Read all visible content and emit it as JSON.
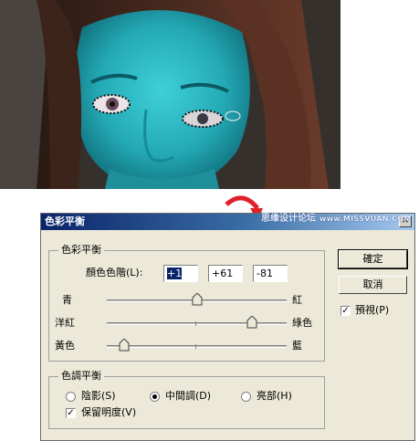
{
  "dialog": {
    "title": "色彩平衡",
    "close_glyph": "×"
  },
  "watermark": {
    "text": "思缘设计论坛",
    "url": "www.MISSVUAN.COM"
  },
  "color_balance": {
    "group_label": "色彩平衡",
    "levels_label": "顏色色階(L):",
    "levels": [
      "+1",
      "+61",
      "-81"
    ],
    "sliders": [
      {
        "left": "青",
        "right": "紅",
        "value": 1
      },
      {
        "left": "洋紅",
        "right": "綠色",
        "value": 61
      },
      {
        "left": "黃色",
        "right": "藍",
        "value": -81
      }
    ],
    "range": [
      -100,
      100
    ]
  },
  "tone_balance": {
    "group_label": "色調平衡",
    "options": [
      {
        "label": "陰影(S)",
        "selected": false
      },
      {
        "label": "中間調(D)",
        "selected": true
      },
      {
        "label": "亮部(H)",
        "selected": false
      }
    ],
    "preserve_luminosity": {
      "label": "保留明度(V)",
      "checked": true
    }
  },
  "buttons": {
    "ok": "確定",
    "cancel": "取消",
    "preview": {
      "label": "預視(P)",
      "checked": true
    }
  },
  "colors": {
    "title_start": "#0a246a",
    "title_end": "#a6caf0",
    "skin": "#29b3bf",
    "arrow": "#e0202a"
  }
}
